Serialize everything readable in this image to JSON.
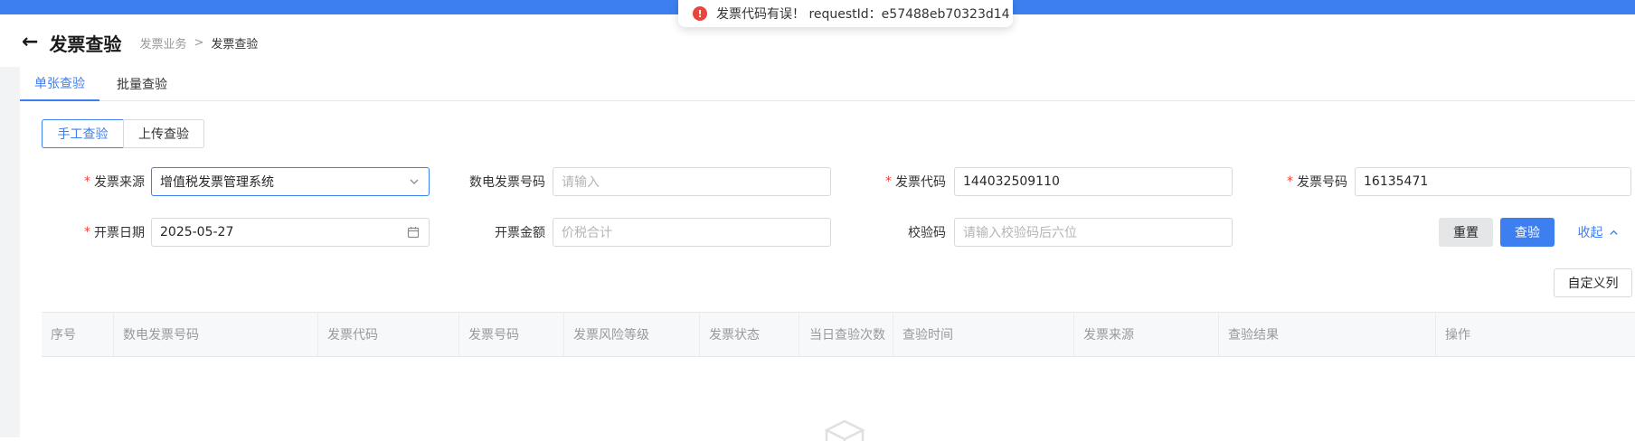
{
  "toast": {
    "message": "发票代码有误！ requestId：e57488eb70323d14",
    "icon": "error-circle-icon"
  },
  "header": {
    "back_icon": "arrow-left-icon",
    "title": "发票查验"
  },
  "breadcrumb": {
    "parent": "发票业务",
    "separator": ">",
    "current": "发票查验"
  },
  "tabs": [
    {
      "label": "单张查验",
      "active": true
    },
    {
      "label": "批量查验",
      "active": false
    }
  ],
  "mode_toggle": [
    {
      "label": "手工查验",
      "active": true
    },
    {
      "label": "上传查验",
      "active": false
    }
  ],
  "form": {
    "source": {
      "label": "发票来源",
      "required": true,
      "value": "增值税发票管理系统"
    },
    "digital_number": {
      "label": "数电发票号码",
      "required": false,
      "placeholder": "请输入"
    },
    "invoice_code": {
      "label": "发票代码",
      "required": true,
      "value": "144032509110"
    },
    "invoice_number": {
      "label": "发票号码",
      "required": true,
      "value": "16135471"
    },
    "issue_date": {
      "label": "开票日期",
      "required": true,
      "value": "2025-05-27"
    },
    "amount": {
      "label": "开票金额",
      "required": false,
      "placeholder": "价税合计"
    },
    "check_code": {
      "label": "校验码",
      "required": false,
      "placeholder": "请输入校验码后六位"
    },
    "required_mark": "*"
  },
  "buttons": {
    "reset": "重置",
    "query": "查验",
    "collapse": "收起",
    "custom_columns": "自定义列"
  },
  "table": {
    "columns": [
      "序号",
      "数电发票号码",
      "发票代码",
      "发票号码",
      "发票风险等级",
      "发票状态",
      "当日查验次数",
      "查验时间",
      "发票来源",
      "查验结果",
      "操作"
    ],
    "rows": []
  },
  "colors": {
    "accent": "#3d7ff0",
    "required": "#e8453c"
  }
}
